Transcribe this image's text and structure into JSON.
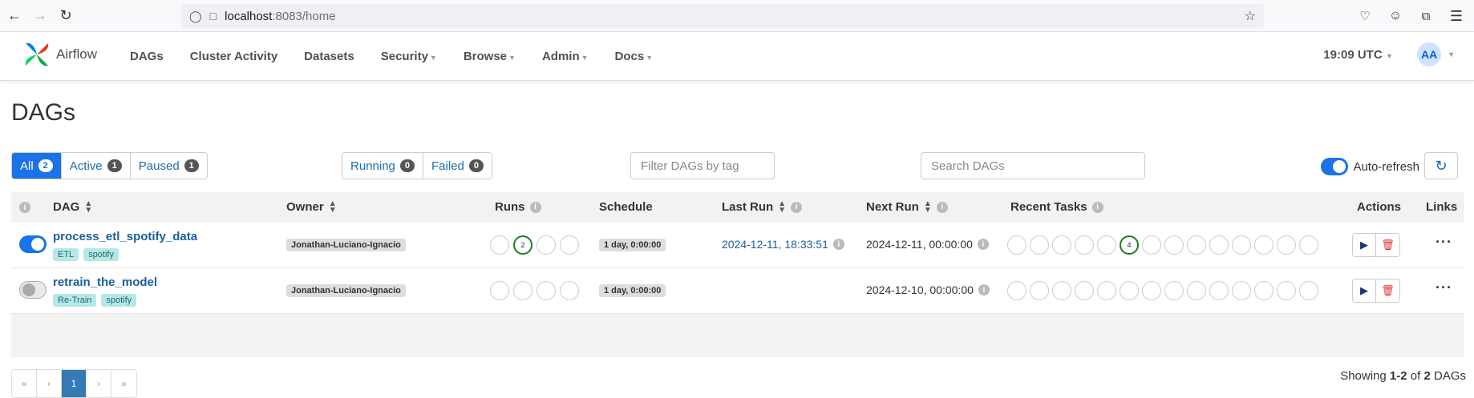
{
  "browser": {
    "url_host": "localhost",
    "url_path": ":8083/home"
  },
  "nav": {
    "brand": "Airflow",
    "menu": [
      {
        "label": "DAGs",
        "caret": false
      },
      {
        "label": "Cluster Activity",
        "caret": false
      },
      {
        "label": "Datasets",
        "caret": false
      },
      {
        "label": "Security",
        "caret": true
      },
      {
        "label": "Browse",
        "caret": true
      },
      {
        "label": "Admin",
        "caret": true
      },
      {
        "label": "Docs",
        "caret": true
      }
    ],
    "clock": "19:09 UTC",
    "avatar": "AA"
  },
  "page": {
    "title": "DAGs"
  },
  "filters": {
    "all": {
      "label": "All",
      "count": "2"
    },
    "active": {
      "label": "Active",
      "count": "1"
    },
    "paused": {
      "label": "Paused",
      "count": "1"
    },
    "running": {
      "label": "Running",
      "count": "0"
    },
    "failed": {
      "label": "Failed",
      "count": "0"
    },
    "tag_placeholder": "Filter DAGs by tag",
    "search_placeholder": "Search DAGs",
    "auto_refresh": "Auto-refresh"
  },
  "table": {
    "headers": {
      "dag": "DAG",
      "owner": "Owner",
      "runs": "Runs",
      "schedule": "Schedule",
      "last_run": "Last Run",
      "next_run": "Next Run",
      "recent_tasks": "Recent Tasks",
      "actions": "Actions",
      "links": "Links"
    },
    "rows": [
      {
        "dag_id": "process_etl_spotify_data",
        "active": true,
        "tags": [
          "ETL",
          "spotify"
        ],
        "owner": "Jonathan-Luciano-Ignacio",
        "runs": [
          "",
          "2",
          "",
          ""
        ],
        "schedule": "1 day, 0:00:00",
        "last_run": "2024-12-11, 18:33:51",
        "next_run": "2024-12-11, 00:00:00",
        "recent_tasks": [
          "",
          "",
          "",
          "",
          "",
          "4",
          "",
          "",
          "",
          "",
          "",
          "",
          "",
          ""
        ]
      },
      {
        "dag_id": "retrain_the_model",
        "active": false,
        "tags": [
          "Re-Train",
          "spotify"
        ],
        "owner": "Jonathan-Luciano-Ignacio",
        "runs": [
          "",
          "",
          "",
          ""
        ],
        "schedule": "1 day, 0:00:00",
        "last_run": "",
        "next_run": "2024-12-10, 00:00:00",
        "recent_tasks": [
          "",
          "",
          "",
          "",
          "",
          "",
          "",
          "",
          "",
          "",
          "",
          "",
          "",
          ""
        ]
      }
    ]
  },
  "pagination": {
    "first": "«",
    "prev": "‹",
    "current": "1",
    "next": "›",
    "last": "»"
  },
  "showing": {
    "prefix": "Showing ",
    "range": "1-2",
    "of": " of ",
    "total": "2",
    "suffix": " DAGs"
  },
  "colors": {
    "accent": "#1a73e8",
    "success_ring": "#1e7d1e",
    "tag_bg": "#b7e8e8",
    "delete_red": "#dd3333"
  }
}
